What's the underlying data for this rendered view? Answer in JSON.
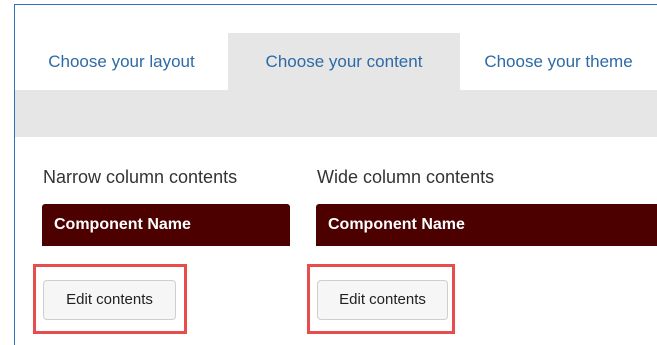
{
  "tabs": [
    {
      "label": "Choose your layout",
      "active": false
    },
    {
      "label": "Choose your content",
      "active": true
    },
    {
      "label": "Choose your theme",
      "active": false
    }
  ],
  "columns": {
    "narrow": {
      "heading": "Narrow column contents",
      "component_name": "Component Name",
      "edit_label": "Edit contents"
    },
    "wide": {
      "heading": "Wide column contents",
      "component_name": "Component Name",
      "edit_label": "Edit contents"
    }
  },
  "colors": {
    "tab_text": "#2d6aa6",
    "active_tab_bg": "#e6e6e6",
    "component_bar": "#4d0000",
    "highlight_border": "#e84d4d",
    "frame_border": "#2d73b8"
  }
}
